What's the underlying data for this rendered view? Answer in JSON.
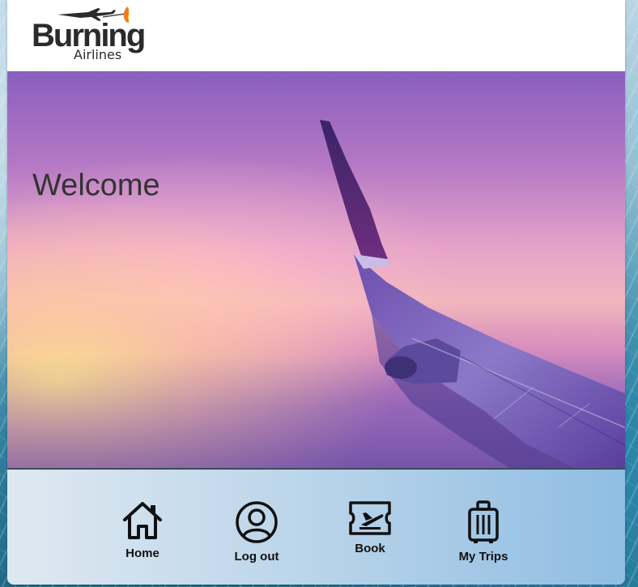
{
  "brand": {
    "name": "Burning",
    "subtitle": "Airlines"
  },
  "hero": {
    "heading": "Welcome"
  },
  "nav": {
    "items": [
      {
        "label": "Home",
        "icon": "home-icon"
      },
      {
        "label": "Log out",
        "icon": "user-circle-icon"
      },
      {
        "label": "Book",
        "icon": "ticket-plane-icon"
      },
      {
        "label": "My Trips",
        "icon": "suitcase-icon"
      }
    ]
  },
  "colors": {
    "header_bg": "#ffffff",
    "text_dark": "#333333",
    "nav_gradient_start": "#dfe8f1",
    "nav_gradient_end": "#8fbde3"
  }
}
